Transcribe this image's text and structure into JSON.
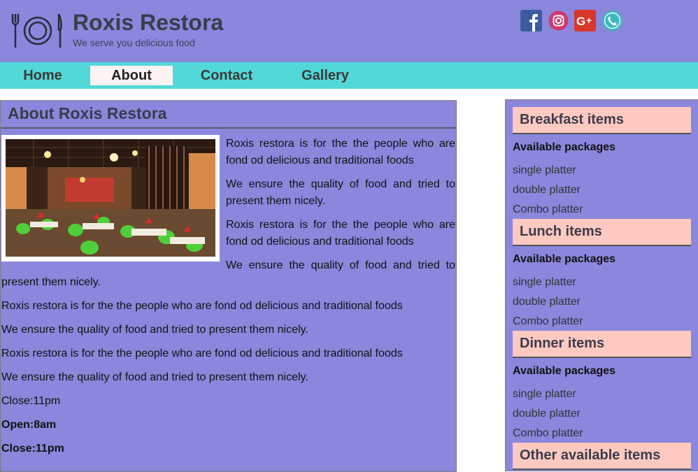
{
  "header": {
    "title": "Roxis Restora",
    "tagline": "We serve you delicious food",
    "logo_icon": "fork-plate-knife-icon",
    "social": [
      "facebook-icon",
      "instagram-icon",
      "google-plus-icon",
      "phone-icon"
    ]
  },
  "nav": {
    "items": [
      "Home",
      "About",
      "Contact",
      "Gallery"
    ],
    "active": "About"
  },
  "main": {
    "title": "About Roxis Restora",
    "para1": "Roxis restora is for the the people who are fond od delicious and traditional foods",
    "para2": "We ensure the quality of food and tried to present them nicely.",
    "para3": "Roxis restora is for the the people who are fond od delicious and traditional foods",
    "para4a": "We ensure the quality of food and tried to",
    "para4b": "present them nicely.",
    "para5": "Roxis restora is for the the people who are fond od delicious and traditional foods",
    "para6": "We ensure the quality of food and tried to present them nicely.",
    "para7": "Roxis restora is for the the people who are fond od delicious and traditional foods",
    "para8": "We ensure the quality of food and tried to present them nicely.",
    "close1": "Close:11pm",
    "open": "Open:8am",
    "close2": "Close:11pm"
  },
  "sidebar": {
    "sections": [
      {
        "title": "Breakfast items",
        "subtitle": "Available packages",
        "items": [
          "single platter",
          "double platter",
          "Combo platter"
        ]
      },
      {
        "title": "Lunch items",
        "subtitle": "Available packages",
        "items": [
          "single platter",
          "double platter",
          "Combo platter"
        ]
      },
      {
        "title": "Dinner items",
        "subtitle": "Available packages",
        "items": [
          "single platter",
          "double platter",
          "Combo platter"
        ]
      },
      {
        "title": "Other available items"
      }
    ]
  },
  "colors": {
    "header_bg": "#8a87dd",
    "nav_bg": "#52d8d8",
    "active_tab": "#fdf3f3",
    "section_head": "#fdc9c1"
  }
}
